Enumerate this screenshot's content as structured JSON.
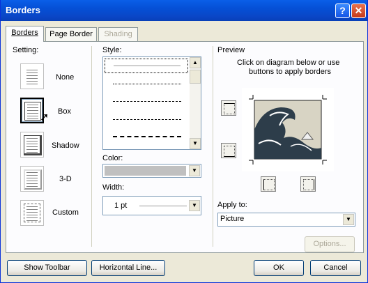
{
  "window": {
    "title": "Borders",
    "help_glyph": "?",
    "close_glyph": "✕"
  },
  "tabs": [
    {
      "label": "Borders",
      "active": true
    },
    {
      "label": "Page Border",
      "active": false
    },
    {
      "label": "Shading",
      "disabled": true
    }
  ],
  "setting": {
    "label": "Setting:",
    "options": [
      {
        "label": "None",
        "selected": false
      },
      {
        "label": "Box",
        "selected": true
      },
      {
        "label": "Shadow",
        "selected": false
      },
      {
        "label": "3-D",
        "selected": false
      },
      {
        "label": "Custom",
        "selected": false
      }
    ]
  },
  "style": {
    "label": "Style:"
  },
  "color": {
    "label": "Color:",
    "value": "#c0c0c0"
  },
  "width": {
    "label": "Width:",
    "value": "1 pt"
  },
  "preview": {
    "label": "Preview",
    "instructions_line1": "Click on diagram below or use",
    "instructions_line2": "buttons to apply borders"
  },
  "apply_to": {
    "label": "Apply to:",
    "value": "Picture"
  },
  "buttons": {
    "options": "Options...",
    "show_toolbar": "Show Toolbar",
    "horizontal_line": "Horizontal Line...",
    "ok": "OK",
    "cancel": "Cancel"
  },
  "colors": {
    "title_bar": "#0a5fe8",
    "dialog_bg": "#ece9d8",
    "panel_bg": "#fcfcfe"
  }
}
